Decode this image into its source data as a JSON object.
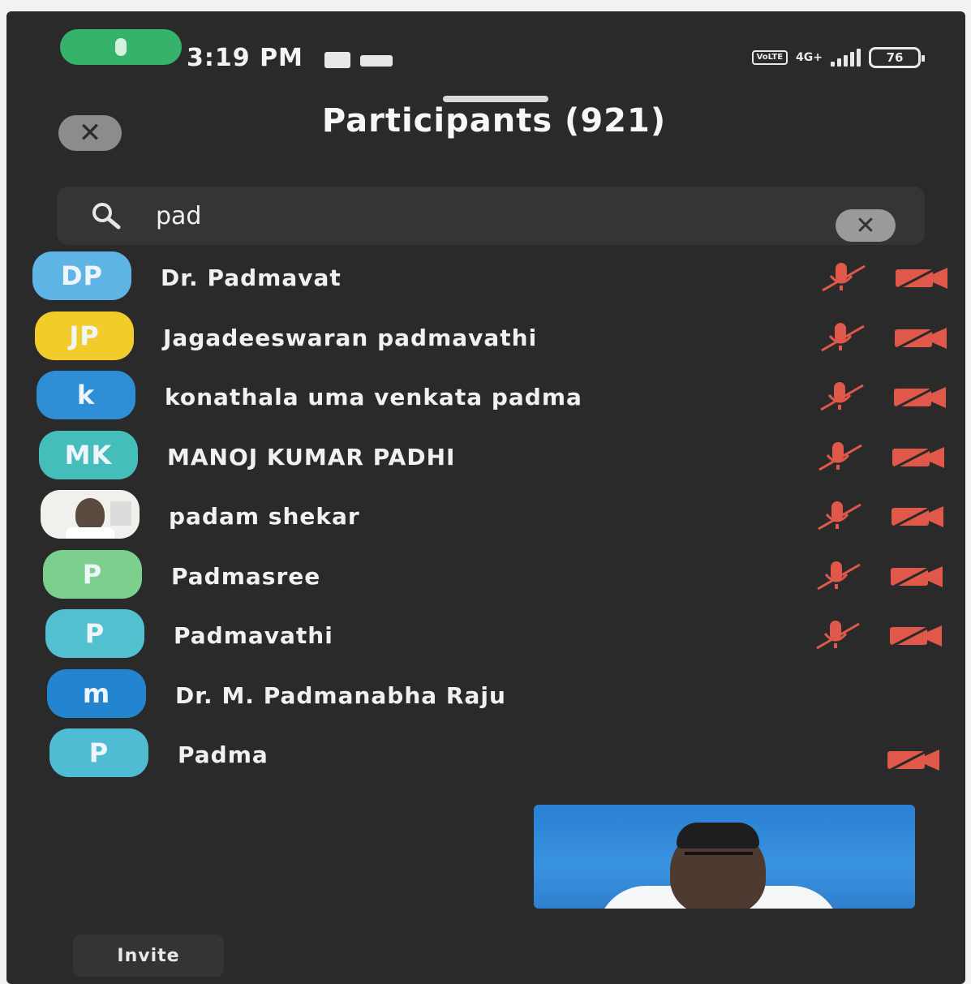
{
  "status_bar": {
    "time": "3:19 PM",
    "network": "4G+",
    "volte": "VoLTE",
    "battery": "76"
  },
  "header": {
    "title": "Participants (921)"
  },
  "search": {
    "value": "pad"
  },
  "participants": [
    {
      "initials": "DP",
      "name": "Dr. Padmavat",
      "avatar_color": "#5fb4e6",
      "mic_muted": true,
      "video_off": true
    },
    {
      "initials": "JP",
      "name": "Jagadeeswaran padmavathi",
      "avatar_color": "#f2cc2a",
      "mic_muted": true,
      "video_off": true
    },
    {
      "initials": "k",
      "name": "konathala uma venkata padma",
      "avatar_color": "#2e8fd6",
      "mic_muted": true,
      "video_off": true
    },
    {
      "initials": "MK",
      "name": "MANOJ KUMAR PADHI",
      "avatar_color": "#45bdbb",
      "mic_muted": true,
      "video_off": true
    },
    {
      "initials": "",
      "name": "padam shekar",
      "avatar_color": "#f0f0ec",
      "photo": true,
      "mic_muted": true,
      "video_off": true
    },
    {
      "initials": "P",
      "name": "Padmasree",
      "avatar_color": "#7dcf8e",
      "mic_muted": true,
      "video_off": true
    },
    {
      "initials": "P",
      "name": "Padmavathi",
      "avatar_color": "#52c1cf",
      "mic_muted": true,
      "video_off": true
    },
    {
      "initials": "m",
      "name": "Dr. M. Padmanabha Raju",
      "avatar_color": "#2385d0",
      "mic_muted": false,
      "video_off": false
    },
    {
      "initials": "P",
      "name": "Padma",
      "avatar_color": "#4fbcd4",
      "mic_muted": false,
      "video_off": true
    }
  ],
  "footer": {
    "invite_label": "Invite"
  },
  "colors": {
    "background": "#2a2a2a",
    "muted_icon": "#e0584a",
    "active_speaker_pill": "#36b36a"
  }
}
